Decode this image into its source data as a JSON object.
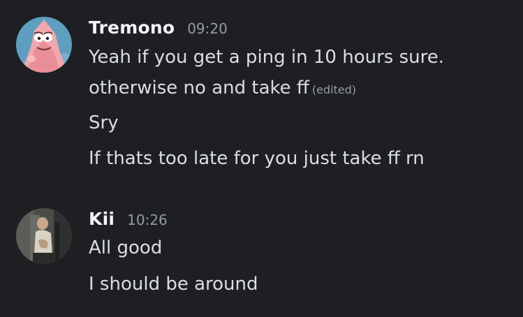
{
  "colors": {
    "background": "#1e1f22",
    "username": "#f2f3f5",
    "message_text": "#dbdee1",
    "muted": "#949ba4"
  },
  "messages": [
    {
      "author": "Tremono",
      "time": "09:20",
      "avatar_icon": "patrick-star-avatar",
      "lines": [
        "Yeah if you get a ping in 10 hours sure.",
        "otherwise no and take ff",
        "Sry",
        "If thats too late for you just take ff rn"
      ],
      "edited_label": "(edited)"
    },
    {
      "author": "Kii",
      "time": "10:26",
      "avatar_icon": "photo-avatar",
      "lines": [
        "All good",
        "I should be around"
      ]
    }
  ]
}
